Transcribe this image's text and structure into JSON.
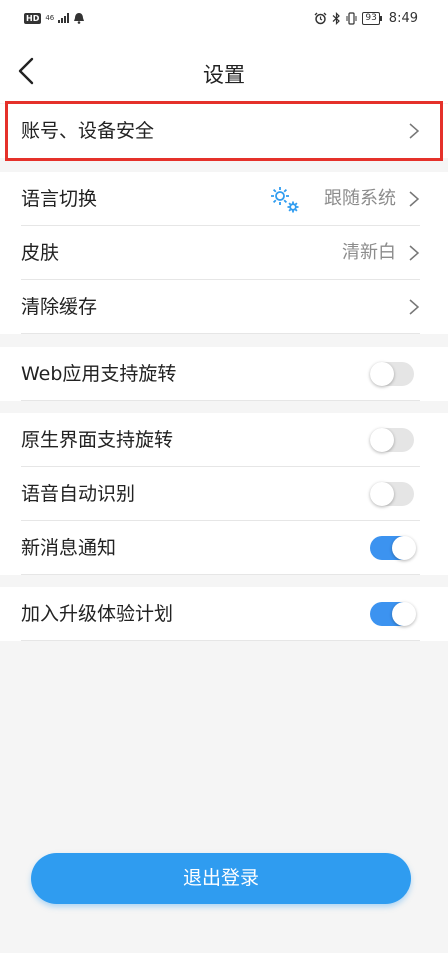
{
  "status_bar": {
    "hd": "HD",
    "network": "46",
    "battery": "93",
    "time": "8:49"
  },
  "header": {
    "title": "设置"
  },
  "groups": [
    {
      "items": [
        {
          "label": "账号、设备安全",
          "type": "link"
        }
      ]
    },
    {
      "items": [
        {
          "label": "语言切换",
          "value": "跟随系统",
          "type": "link",
          "icon": "gear-icon"
        },
        {
          "label": "皮肤",
          "value": "清新白",
          "type": "link"
        },
        {
          "label": "清除缓存",
          "type": "link"
        }
      ]
    },
    {
      "items": [
        {
          "label": "Web应用支持旋转",
          "type": "toggle",
          "on": false
        }
      ]
    },
    {
      "items": [
        {
          "label": "原生界面支持旋转",
          "type": "toggle",
          "on": false
        },
        {
          "label": "语音自动识别",
          "type": "toggle",
          "on": false
        },
        {
          "label": "新消息通知",
          "type": "toggle",
          "on": true
        }
      ]
    },
    {
      "items": [
        {
          "label": "加入升级体验计划",
          "type": "toggle",
          "on": true
        }
      ]
    }
  ],
  "logout_label": "退出登录",
  "colors": {
    "accent": "#2f9cf0",
    "highlight": "#e5312a",
    "toggle_on": "#3c93f0"
  }
}
